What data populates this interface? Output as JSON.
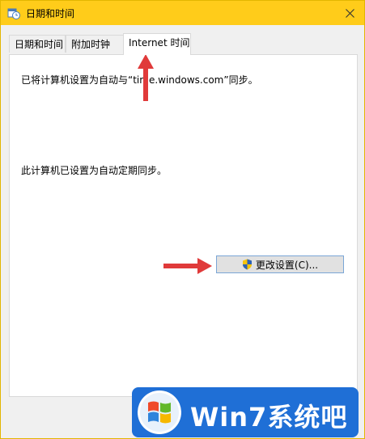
{
  "window": {
    "title": "日期和时间"
  },
  "tabs": [
    {
      "label": "日期和时间"
    },
    {
      "label": "附加时钟"
    },
    {
      "label": "Internet 时间"
    }
  ],
  "panel": {
    "sync_message": "已将计算机设置为自动与“time.windows.com”同步。",
    "schedule_message": "此计算机已设置为自动定期同步。",
    "change_button": "更改设置(C)..."
  },
  "watermark": {
    "text": "Win7系统吧"
  },
  "colors": {
    "titlebar": "#ffcc1a",
    "annotation_arrow": "#e03a3a"
  },
  "icons": [
    "date-time-icon",
    "close-icon",
    "uac-shield-icon",
    "windows-orb-icon",
    "red-arrow-icon"
  ]
}
